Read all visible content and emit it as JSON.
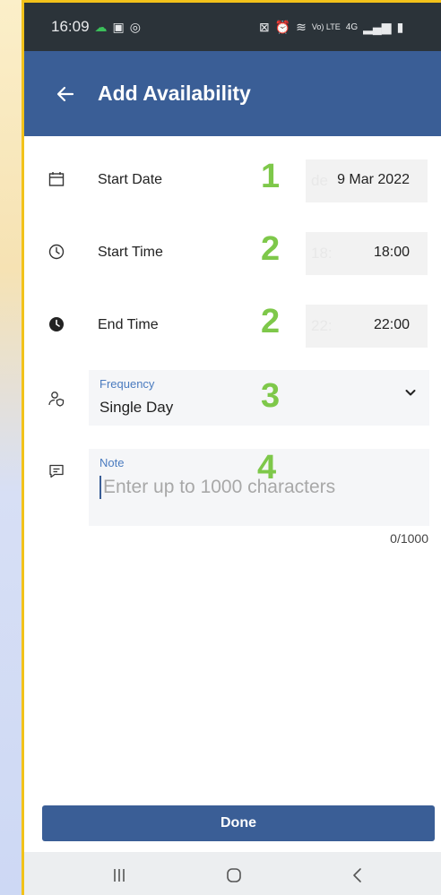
{
  "status_bar": {
    "time": "16:09",
    "right_icons": [
      "battery-saver-icon",
      "alarm-icon",
      "vibrate-icon",
      "volte-icon",
      "4g-icon",
      "signal-icon",
      "battery-icon"
    ],
    "volte_text": "Vo) LTE",
    "network_text": "4G"
  },
  "app_bar": {
    "title": "Add Availability",
    "background_color": "#3a5e96"
  },
  "start_date": {
    "label": "Start Date",
    "marker": "1",
    "ghost": "de",
    "value": "9 Mar 2022"
  },
  "start_time": {
    "label": "Start Time",
    "marker": "2",
    "ghost": "18:",
    "value": "18:00"
  },
  "end_time": {
    "label": "End Time",
    "marker": "2",
    "ghost": "22:",
    "value": "22:00"
  },
  "frequency": {
    "caption": "Frequency",
    "value": "Single Day",
    "marker": "3"
  },
  "note": {
    "caption": "Note",
    "placeholder": "Enter up to 1000 characters",
    "marker": "4",
    "counter": "0/1000"
  },
  "done_label": "Done"
}
